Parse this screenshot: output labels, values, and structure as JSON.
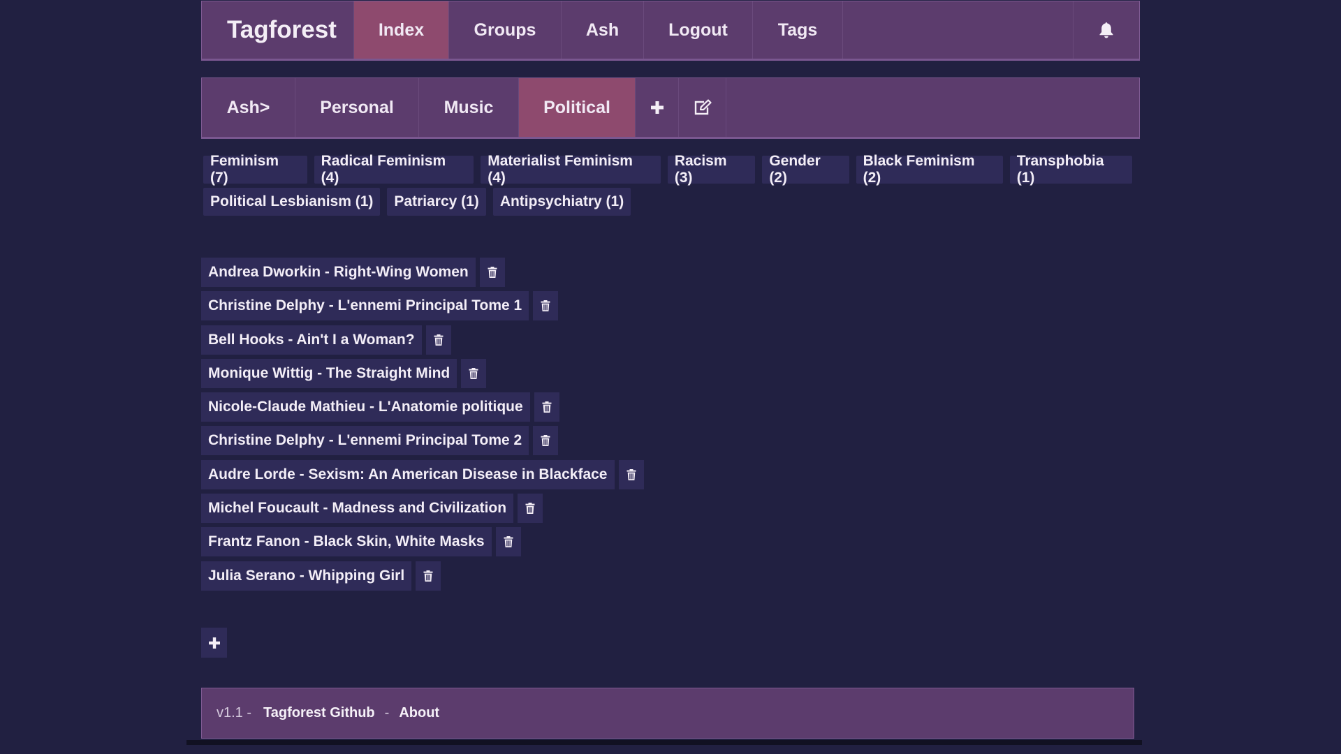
{
  "nav": {
    "brand": "Tagforest",
    "items": [
      {
        "label": "Index",
        "active": true
      },
      {
        "label": "Groups",
        "active": false
      },
      {
        "label": "Ash",
        "active": false
      },
      {
        "label": "Logout",
        "active": false
      },
      {
        "label": "Tags",
        "active": false
      }
    ],
    "bell_icon": "bell-icon"
  },
  "groups": {
    "tabs": [
      {
        "label": "Ash>",
        "active": false
      },
      {
        "label": "Personal",
        "active": false
      },
      {
        "label": "Music",
        "active": false
      },
      {
        "label": "Political",
        "active": true
      }
    ],
    "add_icon": "plus-icon",
    "edit_icon": "edit-icon"
  },
  "tags": [
    [
      "Feminism (7)",
      "Radical Feminism (4)",
      "Materialist Feminism (4)",
      "Racism (3)",
      "Gender (2)",
      "Black Feminism (2)",
      "Transphobia (1)"
    ],
    [
      "Political Lesbianism (1)",
      "Patriarcy (1)",
      "Antipsychiatry (1)"
    ]
  ],
  "items": [
    "Andrea Dworkin - Right-Wing Women",
    "Christine Delphy - L'ennemi Principal Tome 1",
    "Bell Hooks - Ain't I a Woman?",
    "Monique Wittig - The Straight Mind",
    "Nicole-Claude Mathieu - L'Anatomie politique",
    "Christine Delphy - L'ennemi Principal Tome 2",
    "Audre Lorde - Sexism: An American Disease in Blackface",
    "Michel Foucault - Madness and Civilization",
    "Frantz Fanon - Black Skin, White Masks",
    "Julia Serano - Whipping Girl"
  ],
  "add_item_icon": "plus-icon",
  "footer": {
    "version": "v1.1 -",
    "github": "Tagforest Github",
    "separator": "-",
    "about": "About"
  },
  "colors": {
    "background": "#212041",
    "bar": "#5c3c6d",
    "active": "#8e4a6e",
    "pill": "#2f2b58"
  }
}
